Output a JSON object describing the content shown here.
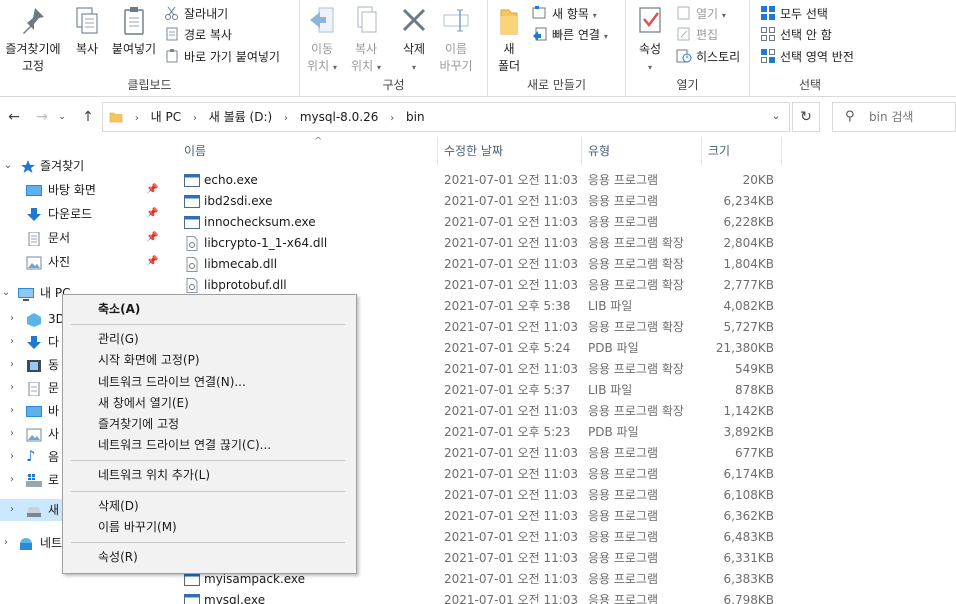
{
  "ribbon": {
    "clipboard": {
      "group_label": "클립보드",
      "pin_label": "즐겨찾기에\n고정",
      "copy_label": "복사",
      "paste_label": "붙여넣기",
      "cut_label": "잘라내기",
      "copy_path_label": "경로 복사",
      "paste_shortcut_label": "바로 가기 붙여넣기"
    },
    "organize": {
      "group_label": "구성",
      "move_label": "이동\n위치",
      "copyto_label": "복사\n위치",
      "delete_label": "삭제",
      "rename_label": "이름\n바꾸기"
    },
    "new": {
      "group_label": "새로 만들기",
      "new_folder_label": "새\n폴더",
      "new_item_label": "새 항목",
      "easy_access_label": "빠른 연결"
    },
    "open": {
      "group_label": "열기",
      "properties_label": "속성",
      "open_label": "열기",
      "edit_label": "편집",
      "history_label": "히스토리"
    },
    "select": {
      "group_label": "선택",
      "select_all_label": "모두 선택",
      "select_none_label": "선택 안 함",
      "invert_label": "선택 영역 반전"
    }
  },
  "address": {
    "crumbs": [
      "내 PC",
      "새 볼륨 (D:)",
      "mysql-8.0.26",
      "bin"
    ],
    "search_placeholder": "bin 검색"
  },
  "nav": {
    "quick_access": "즐겨찾기",
    "quick_items": [
      "바탕 화면",
      "다운로드",
      "문서",
      "사진"
    ],
    "this_pc": "내 PC",
    "pc_children": [
      "3D",
      "다",
      "동",
      "문",
      "바",
      "사",
      "음",
      "로",
      "새"
    ],
    "network": "네트"
  },
  "columns": {
    "name": "이름",
    "date": "수정한 날짜",
    "type": "유형",
    "size": "크기"
  },
  "files": [
    {
      "name": "echo.exe",
      "date": "2021-07-01 오전 11:03",
      "type": "응용 프로그램",
      "size": "20KB",
      "kind": "exe"
    },
    {
      "name": "ibd2sdi.exe",
      "date": "2021-07-01 오전 11:03",
      "type": "응용 프로그램",
      "size": "6,234KB",
      "kind": "exe"
    },
    {
      "name": "innochecksum.exe",
      "date": "2021-07-01 오전 11:03",
      "type": "응용 프로그램",
      "size": "6,228KB",
      "kind": "exe"
    },
    {
      "name": "libcrypto-1_1-x64.dll",
      "date": "2021-07-01 오전 11:03",
      "type": "응용 프로그램 확장",
      "size": "2,804KB",
      "kind": "dll"
    },
    {
      "name": "libmecab.dll",
      "date": "2021-07-01 오전 11:03",
      "type": "응용 프로그램 확장",
      "size": "1,804KB",
      "kind": "dll"
    },
    {
      "name": "libprotobuf.dll",
      "date": "2021-07-01 오전 11:03",
      "type": "응용 프로그램 확장",
      "size": "2,777KB",
      "kind": "dll"
    },
    {
      "name": "",
      "date": "2021-07-01 오후 5:38",
      "type": "LIB 파일",
      "size": "4,082KB",
      "kind": "none"
    },
    {
      "name": "",
      "date": "2021-07-01 오전 11:03",
      "type": "응용 프로그램 확장",
      "size": "5,727KB",
      "kind": "none"
    },
    {
      "name": "",
      "date": "2021-07-01 오후 5:24",
      "type": "PDB 파일",
      "size": "21,380KB",
      "kind": "none"
    },
    {
      "name": "",
      "date": "2021-07-01 오전 11:03",
      "type": "응용 프로그램 확장",
      "size": "549KB",
      "kind": "none"
    },
    {
      "name": "",
      "date": "2021-07-01 오후 5:37",
      "type": "LIB 파일",
      "size": "878KB",
      "kind": "none"
    },
    {
      "name": "",
      "date": "2021-07-01 오전 11:03",
      "type": "응용 프로그램 확장",
      "size": "1,142KB",
      "kind": "none"
    },
    {
      "name": "",
      "date": "2021-07-01 오후 5:23",
      "type": "PDB 파일",
      "size": "3,892KB",
      "kind": "none"
    },
    {
      "name": "",
      "date": "2021-07-01 오전 11:03",
      "type": "응용 프로그램",
      "size": "677KB",
      "kind": "none"
    },
    {
      "name": "",
      "date": "2021-07-01 오전 11:03",
      "type": "응용 프로그램",
      "size": "6,174KB",
      "kind": "none"
    },
    {
      "name": "",
      "date": "2021-07-01 오전 11:03",
      "type": "응용 프로그램",
      "size": "6,108KB",
      "kind": "none"
    },
    {
      "name": "",
      "date": "2021-07-01 오전 11:03",
      "type": "응용 프로그램",
      "size": "6,362KB",
      "kind": "none"
    },
    {
      "name": "",
      "date": "2021-07-01 오전 11:03",
      "type": "응용 프로그램",
      "size": "6,483KB",
      "kind": "none"
    },
    {
      "name": "",
      "date": "2021-07-01 오전 11:03",
      "type": "응용 프로그램",
      "size": "6,331KB",
      "kind": "none"
    },
    {
      "name": "myisampack.exe",
      "date": "2021-07-01 오전 11:03",
      "type": "응용 프로그램",
      "size": "6,383KB",
      "kind": "exe"
    },
    {
      "name": "mysql.exe",
      "date": "2021-07-01 오전 11:03",
      "type": "응용 프로그램",
      "size": "6,798KB",
      "kind": "exe"
    }
  ],
  "context_menu": {
    "items": [
      {
        "label": "축소(A)",
        "bold": true
      },
      {
        "sep": true
      },
      {
        "label": "관리(G)"
      },
      {
        "label": "시작 화면에 고정(P)"
      },
      {
        "label": "네트워크 드라이브 연결(N)..."
      },
      {
        "label": "새 창에서 열기(E)"
      },
      {
        "label": "즐겨찾기에 고정"
      },
      {
        "label": "네트워크 드라이브 연결 끊기(C)..."
      },
      {
        "sep": true
      },
      {
        "label": "네트워크 위치 추가(L)"
      },
      {
        "sep": true
      },
      {
        "label": "삭제(D)"
      },
      {
        "label": "이름 바꾸기(M)"
      },
      {
        "sep": true
      },
      {
        "label": "속성(R)"
      }
    ]
  },
  "colors": {
    "selection": "#cce8ff",
    "accent_blue": "#1e78d6",
    "folder_yellow": "#f6c65b",
    "delete_red": "#d9534f"
  }
}
